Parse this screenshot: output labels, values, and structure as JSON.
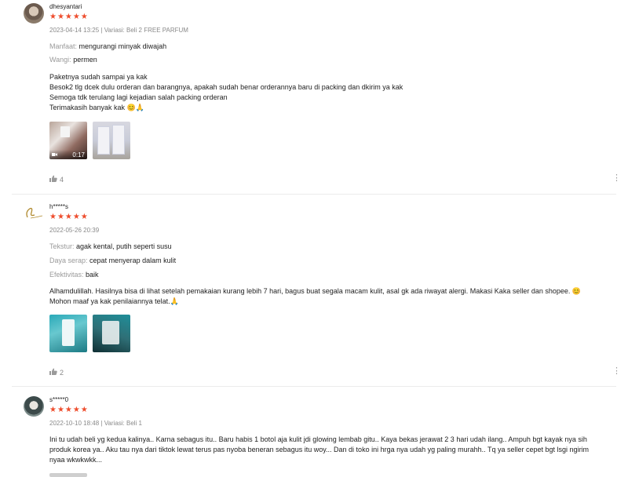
{
  "reviews": [
    {
      "username": "dhesyantari",
      "stars": "★★★★★",
      "meta": "2023-04-14 13:25 | Variasi: Beli 2 FREE PARFUM",
      "attributes": [
        {
          "key": "Manfaat:",
          "value": "mengurangi minyak diwajah"
        },
        {
          "key": "Wangi:",
          "value": "permen"
        }
      ],
      "body_lines": [
        "Paketnya sudah sampai ya kak",
        "Besok2 tlg dcek dulu orderan dan barangnya, apakah sudah benar orderannya baru di packing dan dkirim ya kak",
        "Semoga tdk terulang lagi kejadian salah packing orderan",
        "Terimakasih banyak kak"
      ],
      "emoji": "😊🙏",
      "video_duration": "0:17",
      "likes": "4"
    },
    {
      "username": "h*****s",
      "stars": "★★★★★",
      "meta": "2022-05-26 20:39",
      "attributes": [
        {
          "key": "Tekstur:",
          "value": "agak kental, putih seperti susu"
        },
        {
          "key": "Daya serap:",
          "value": "cepat menyerap dalam kulit"
        },
        {
          "key": "Efektivitas:",
          "value": "baik"
        }
      ],
      "body_lines": [
        "Alhamdulillah. Hasilnya bisa di lihat setelah pemakaian kurang lebih 7 hari, bagus buat segala macam kulit, asal gk ada riwayat alergi. Makasi Kaka seller dan shopee. 😊",
        "Mohon maaf ya kak penilaiannya telat.🙏"
      ],
      "likes": "2"
    },
    {
      "username": "s*****0",
      "stars": "★★★★★",
      "meta": "2022-10-10 18:48 | Variasi: Beli 1",
      "body_lines": [
        "Ini tu udah beli yg kedua kalinya.. Karna sebagus itu.. Baru habis 1 botol aja kulit jdi glowing lembab gitu.. Kaya bekas jerawat 2 3 hari udah ilang.. Ampuh bgt kayak nya sih",
        "produk korea ya.. Aku tau nya dari tiktok lewat terus pas nyoba beneran sebagus itu woy... Dan di toko ini hrga nya udah yg paling murahh.. Tq ya seller cepet bgt lsgi ngirim",
        "nyaa wkwkwkk..."
      ]
    }
  ],
  "colors": {
    "star": "#ee4d2d",
    "muted": "#8a8a8a"
  },
  "icons": {
    "like": "thumbs-up-icon",
    "more": "more-vertical-icon",
    "video": "video-camera-icon"
  }
}
